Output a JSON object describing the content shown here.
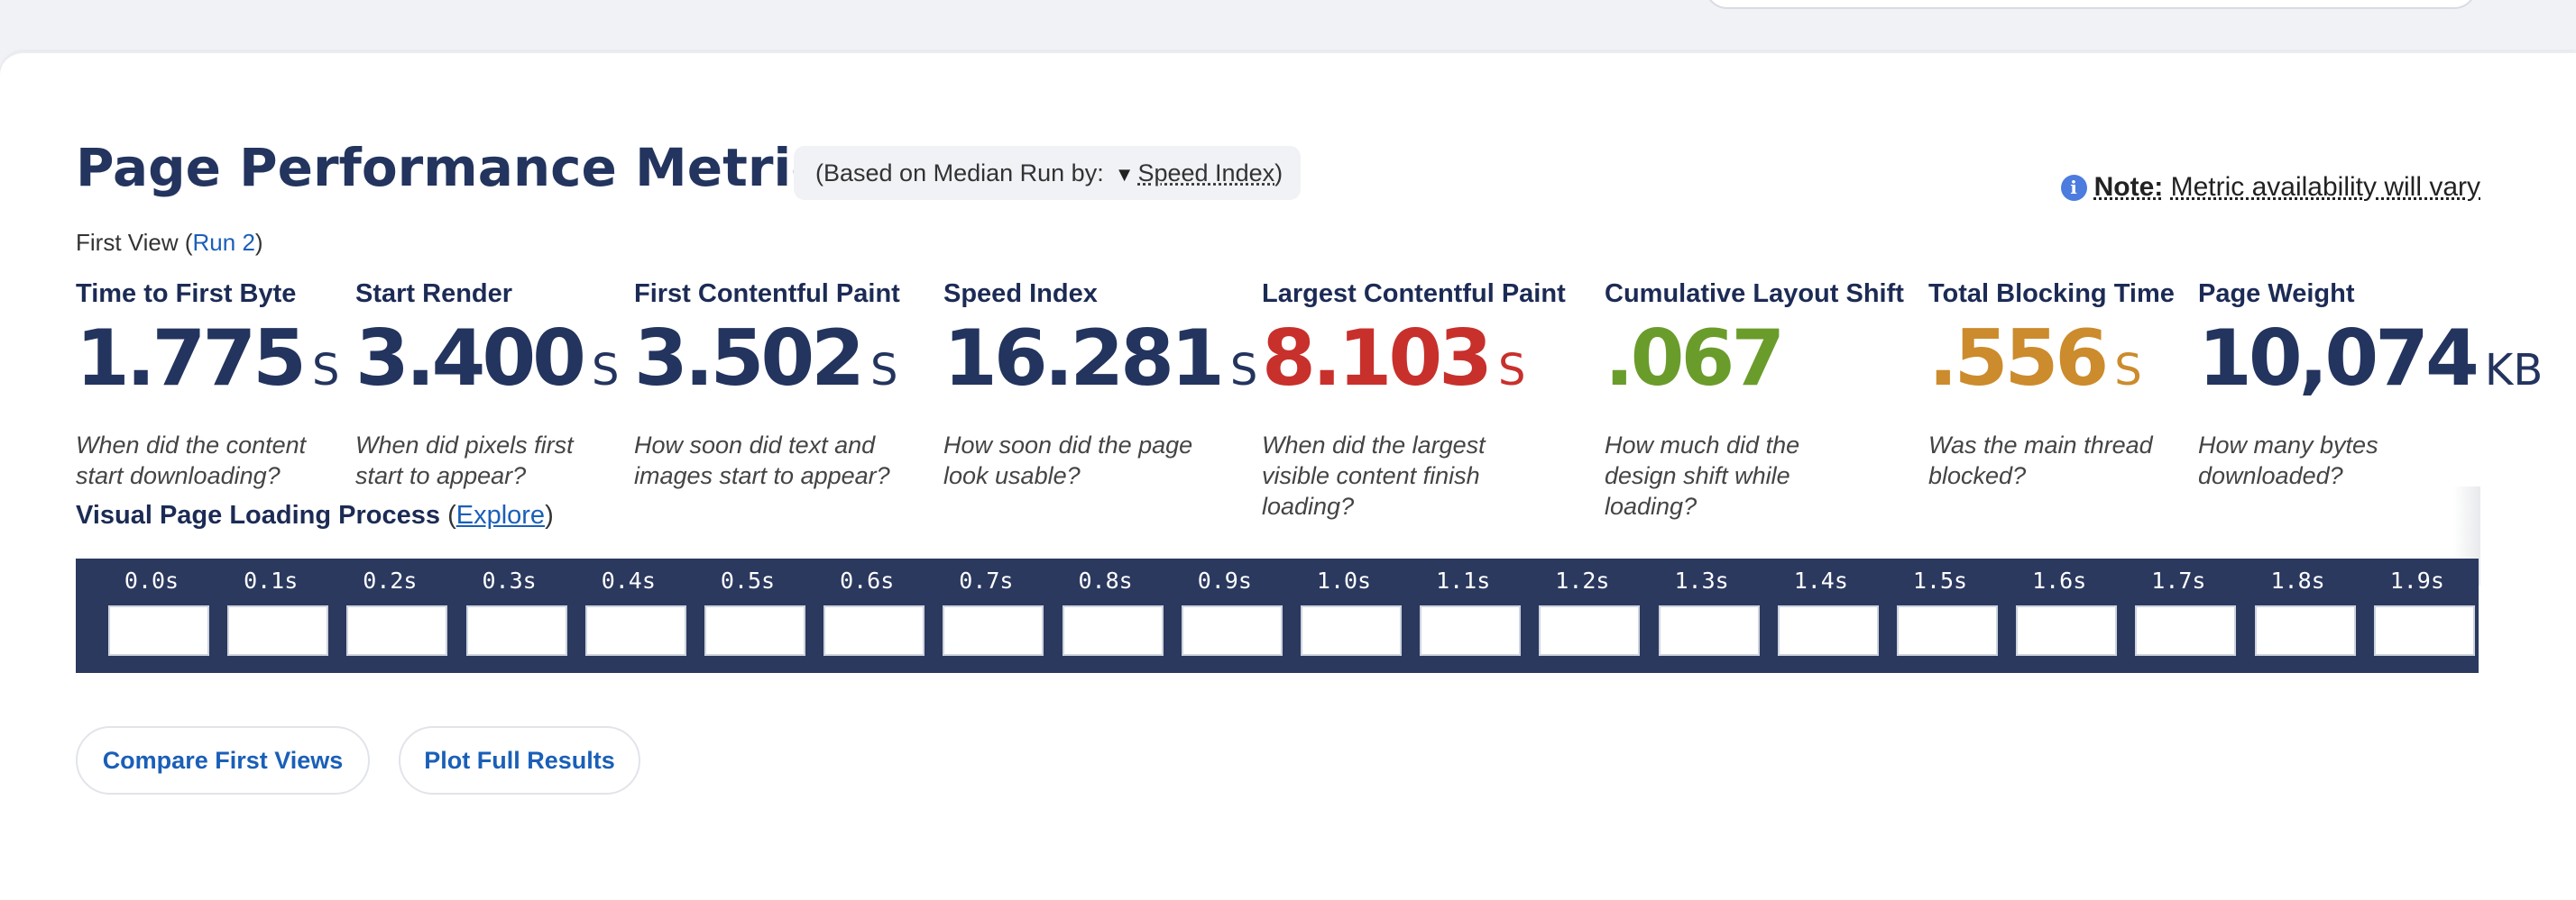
{
  "header": {
    "title": "Page Performance Metrics",
    "median_prefix": "(Based on Median Run by:",
    "median_metric": "Speed Index",
    "median_suffix": ")",
    "note_label": "Note:",
    "note_text": "Metric availability will vary",
    "info_icon_glyph": "i"
  },
  "run": {
    "view_label": "First View (",
    "run_link": "Run 2",
    "close": ")"
  },
  "metrics": [
    {
      "label": "Time to First Byte",
      "value": "1.775",
      "unit": "S",
      "description": "When did the content start downloading?",
      "color": "#23345e"
    },
    {
      "label": "Start Render",
      "value": "3.400",
      "unit": "S",
      "description": "When did pixels first start to appear?",
      "color": "#23345e"
    },
    {
      "label": "First Contentful Paint",
      "value": "3.502",
      "unit": "S",
      "description": "How soon did text and images start to appear?",
      "color": "#23345e"
    },
    {
      "label": "Speed Index",
      "value": "16.281",
      "unit": "S",
      "description": "How soon did the page look usable?",
      "color": "#23345e"
    },
    {
      "label": "Largest Contentful Paint",
      "value": "8.103",
      "unit": "S",
      "description": "When did the largest visible content finish loading?",
      "color": "#c8302c"
    },
    {
      "label": "Cumulative Layout Shift",
      "value": ".067",
      "unit": "",
      "description": "How much did the design shift while loading?",
      "color": "#6a9c2b"
    },
    {
      "label": "Total Blocking Time",
      "value": ".556",
      "unit": "S",
      "description": "Was the main thread blocked?",
      "color": "#cc8b2c"
    },
    {
      "label": "Page Weight",
      "value": "10,074",
      "unit": "KB",
      "description": "How many bytes downloaded?",
      "color": "#23345e"
    }
  ],
  "visual": {
    "title": "Visual Page Loading Process",
    "open_paren": " (",
    "explore_link": "Explore",
    "close_paren": ")",
    "frames": [
      "0.0s",
      "0.1s",
      "0.2s",
      "0.3s",
      "0.4s",
      "0.5s",
      "0.6s",
      "0.7s",
      "0.8s",
      "0.9s",
      "1.0s",
      "1.1s",
      "1.2s",
      "1.3s",
      "1.4s",
      "1.5s",
      "1.6s",
      "1.7s",
      "1.8s",
      "1.9s"
    ]
  },
  "actions": {
    "compare": "Compare First Views",
    "plot": "Plot Full Results"
  }
}
